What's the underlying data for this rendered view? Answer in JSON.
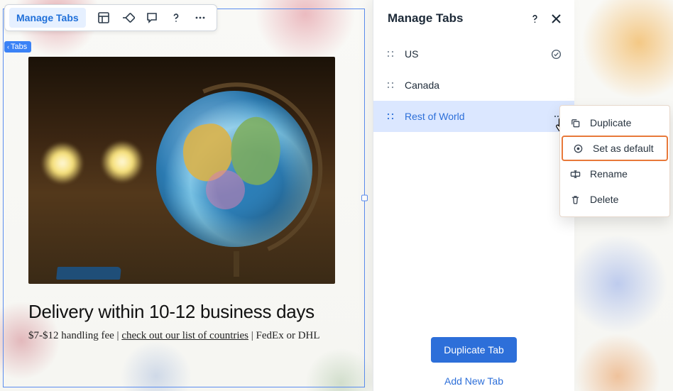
{
  "toolbar": {
    "manage_tabs_label": "Manage Tabs",
    "tag_label": "Tabs"
  },
  "content": {
    "headline": "Delivery within 10-12 business days",
    "sub_seg1": "$7-$12 handling fee | ",
    "sub_seg2": "check out our list of countries",
    "sub_seg3": " | FedEx or DHL"
  },
  "panel": {
    "title": "Manage Tabs",
    "tabs": [
      {
        "label": "US",
        "default": true
      },
      {
        "label": "Canada",
        "default": false
      },
      {
        "label": "Rest of World",
        "default": false
      }
    ],
    "duplicate_btn": "Duplicate Tab",
    "add_btn": "Add New Tab"
  },
  "context_menu": {
    "items": [
      {
        "label": "Duplicate"
      },
      {
        "label": "Set as default"
      },
      {
        "label": "Rename"
      },
      {
        "label": "Delete"
      }
    ]
  }
}
